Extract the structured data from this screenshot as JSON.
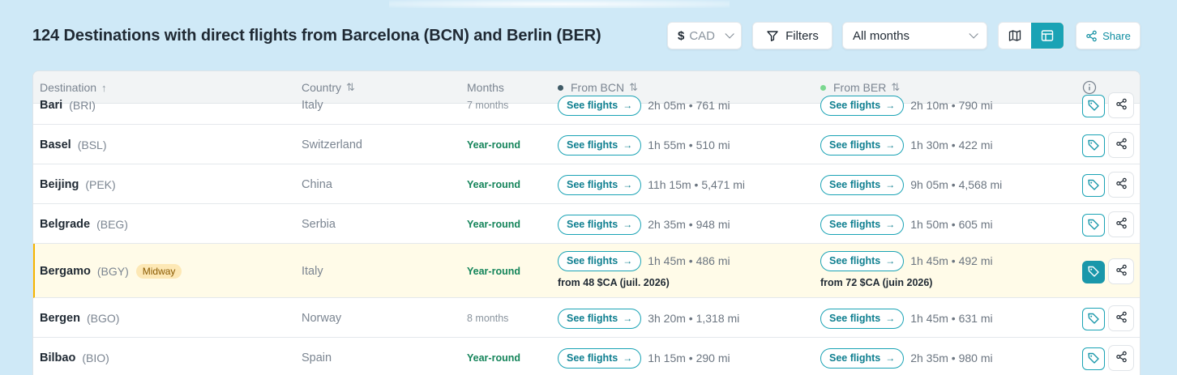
{
  "page": {
    "title": "124 Destinations with direct flights from Barcelona (BCN) and Berlin (BER)"
  },
  "controls": {
    "currency_symbol": "$",
    "currency_code": "CAD",
    "filters_label": "Filters",
    "months_value": "All months",
    "share_label": "Share",
    "active_view": "table"
  },
  "colors": {
    "accent": "#1aa3b5",
    "bcn_dot": "#3f5a66",
    "ber_dot": "#7bd88f",
    "yearround": "#14845a",
    "highlight_bg": "#fffbe8",
    "highlight_border": "#f4b400"
  },
  "table": {
    "headers": {
      "destination": "Destination",
      "country": "Country",
      "months": "Months",
      "from_bcn": "From BCN",
      "from_ber": "From BER"
    },
    "see_flights_label": "See flights",
    "rows": [
      {
        "name": "Bari",
        "code": "(BRI)",
        "country": "Italy",
        "months": "7 months",
        "yearround": false,
        "bcn": "2h 05m • 761 mi",
        "ber": "2h 10m • 790 mi"
      },
      {
        "name": "Basel",
        "code": "(BSL)",
        "country": "Switzerland",
        "months": "Year-round",
        "yearround": true,
        "bcn": "1h 55m • 510 mi",
        "ber": "1h 30m • 422 mi"
      },
      {
        "name": "Beijing",
        "code": "(PEK)",
        "country": "China",
        "months": "Year-round",
        "yearround": true,
        "bcn": "11h 15m • 5,471 mi",
        "ber": "9h 05m • 4,568 mi"
      },
      {
        "name": "Belgrade",
        "code": "(BEG)",
        "country": "Serbia",
        "months": "Year-round",
        "yearround": true,
        "bcn": "2h 35m • 948 mi",
        "ber": "1h 50m • 605 mi"
      },
      {
        "name": "Bergamo",
        "code": "(BGY)",
        "badge": "Midway",
        "country": "Italy",
        "months": "Year-round",
        "yearround": true,
        "bcn": "1h 45m • 486 mi",
        "ber": "1h 45m • 492 mi",
        "bcn_price": "from 48 $CA (juil. 2026)",
        "ber_price": "from 72 $CA (juin 2026)",
        "highlighted": true
      },
      {
        "name": "Bergen",
        "code": "(BGO)",
        "country": "Norway",
        "months": "8 months",
        "yearround": false,
        "bcn": "3h 20m • 1,318 mi",
        "ber": "1h 45m • 631 mi"
      },
      {
        "name": "Bilbao",
        "code": "(BIO)",
        "country": "Spain",
        "months": "Year-round",
        "yearround": true,
        "bcn": "1h 15m • 290 mi",
        "ber": "2h 35m • 980 mi"
      }
    ]
  }
}
